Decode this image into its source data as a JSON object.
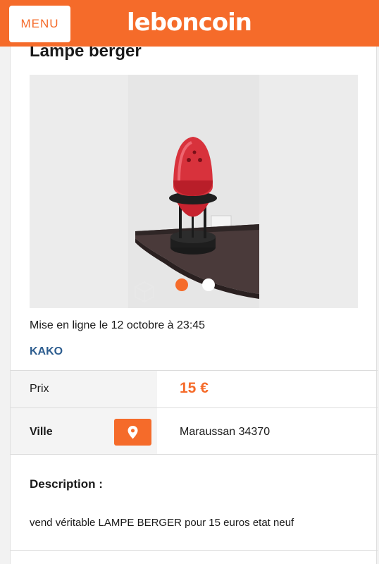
{
  "header": {
    "menu_label": "MENU",
    "logo_text": "leboncoin"
  },
  "ad": {
    "title": "Lampe berger",
    "posted": "Mise en ligne le 12 octobre à 23:45",
    "seller": "KAKO",
    "gallery": {
      "image_count": 2,
      "active_index": 1
    }
  },
  "details": {
    "price_label": "Prix",
    "price_value": "15 €",
    "city_label": "Ville",
    "city_value": "Maraussan 34370",
    "map_icon": "location-pin-icon"
  },
  "description": {
    "label": "Description :",
    "text": "vend véritable LAMPE BERGER pour 15 euros etat neuf"
  },
  "colors": {
    "brand": "#f56b2a",
    "seller_link": "#2d5d8f"
  }
}
